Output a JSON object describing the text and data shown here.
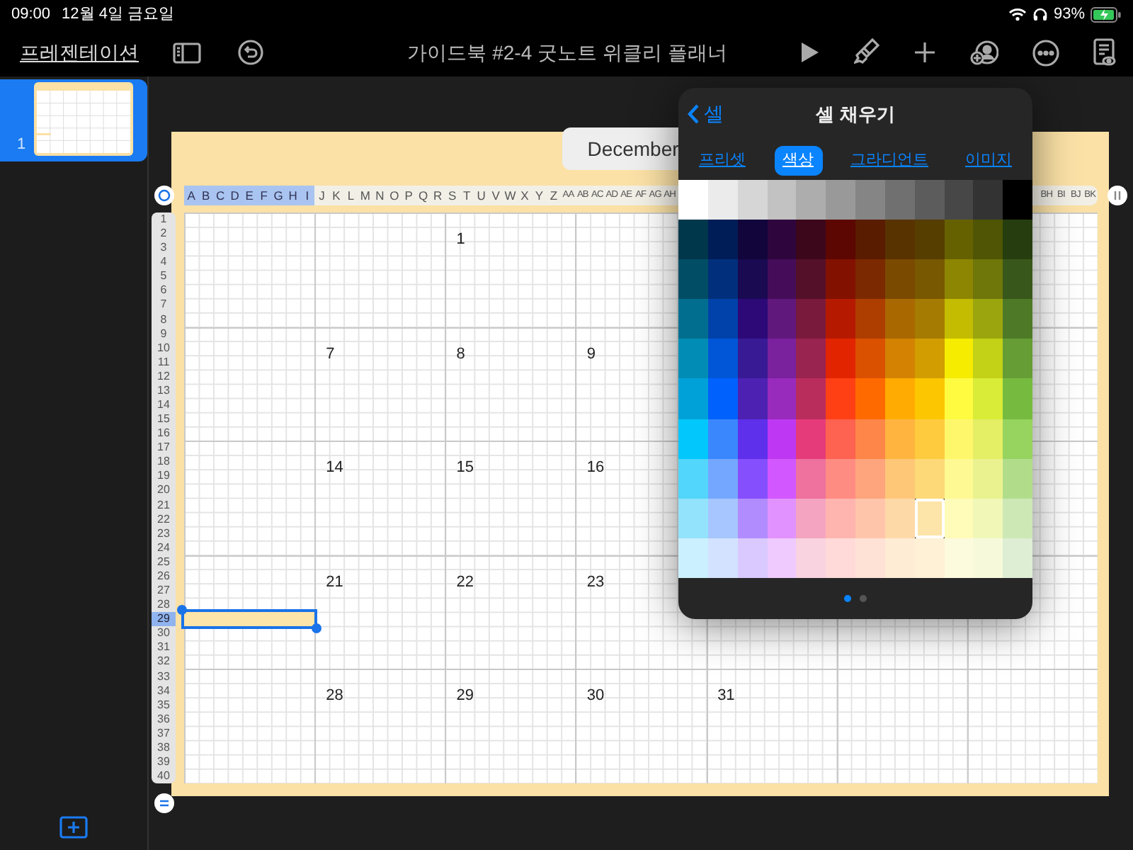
{
  "status_bar": {
    "time": "09:00",
    "date": "12월 4일 금요일",
    "battery": "93%"
  },
  "toolbar": {
    "back_link": "프레젠테이션",
    "title": "가이드북 #2-4 굿노트 위클리 플래너"
  },
  "slides": [
    {
      "number": "1",
      "selected": true
    }
  ],
  "slide": {
    "title": "December"
  },
  "table": {
    "column_headers": [
      {
        "label": "A",
        "selected": true
      },
      {
        "label": "B",
        "selected": true
      },
      {
        "label": "C",
        "selected": true
      },
      {
        "label": "D",
        "selected": true
      },
      {
        "label": "E",
        "selected": true
      },
      {
        "label": "F",
        "selected": true
      },
      {
        "label": "G",
        "selected": true
      },
      {
        "label": "H",
        "selected": true
      },
      {
        "label": "I",
        "selected": true
      },
      {
        "label": "J",
        "selected": false
      },
      {
        "label": "K",
        "selected": false
      },
      {
        "label": "L",
        "selected": false
      },
      {
        "label": "M",
        "selected": false
      },
      {
        "label": "N",
        "selected": false
      },
      {
        "label": "O",
        "selected": false
      },
      {
        "label": "P",
        "selected": false
      },
      {
        "label": "Q",
        "selected": false
      },
      {
        "label": "R",
        "selected": false
      },
      {
        "label": "S",
        "selected": false
      },
      {
        "label": "T",
        "selected": false
      },
      {
        "label": "U",
        "selected": false
      },
      {
        "label": "V",
        "selected": false
      },
      {
        "label": "W",
        "selected": false
      },
      {
        "label": "X",
        "selected": false
      },
      {
        "label": "Y",
        "selected": false
      },
      {
        "label": "Z",
        "selected": false
      },
      {
        "label": "AA",
        "selected": false
      },
      {
        "label": "AB",
        "selected": false
      },
      {
        "label": "AC",
        "selected": false
      },
      {
        "label": "AD",
        "selected": false
      },
      {
        "label": "AE",
        "selected": false
      },
      {
        "label": "AF",
        "selected": false
      },
      {
        "label": "AG",
        "selected": false
      },
      {
        "label": "AH",
        "selected": false
      }
    ],
    "column_headers_end": [
      {
        "label": "BH",
        "selected": false
      },
      {
        "label": "BI",
        "selected": false
      },
      {
        "label": "BJ",
        "selected": false
      },
      {
        "label": "BK",
        "selected": false
      }
    ],
    "row_headers": [
      {
        "label": "1",
        "selected": false
      },
      {
        "label": "2",
        "selected": false
      },
      {
        "label": "3",
        "selected": false
      },
      {
        "label": "4",
        "selected": false
      },
      {
        "label": "5",
        "selected": false
      },
      {
        "label": "6",
        "selected": false
      },
      {
        "label": "7",
        "selected": false
      },
      {
        "label": "8",
        "selected": false
      },
      {
        "label": "9",
        "selected": false
      },
      {
        "label": "10",
        "selected": false
      },
      {
        "label": "11",
        "selected": false
      },
      {
        "label": "12",
        "selected": false
      },
      {
        "label": "13",
        "selected": false
      },
      {
        "label": "14",
        "selected": false
      },
      {
        "label": "15",
        "selected": false
      },
      {
        "label": "16",
        "selected": false
      },
      {
        "label": "17",
        "selected": false
      },
      {
        "label": "18",
        "selected": false
      },
      {
        "label": "19",
        "selected": false
      },
      {
        "label": "20",
        "selected": false
      },
      {
        "label": "21",
        "selected": false
      },
      {
        "label": "22",
        "selected": false
      },
      {
        "label": "23",
        "selected": false
      },
      {
        "label": "24",
        "selected": false
      },
      {
        "label": "25",
        "selected": false
      },
      {
        "label": "26",
        "selected": false
      },
      {
        "label": "27",
        "selected": false
      },
      {
        "label": "28",
        "selected": false
      },
      {
        "label": "29",
        "selected": true
      },
      {
        "label": "30",
        "selected": false
      },
      {
        "label": "31",
        "selected": false
      },
      {
        "label": "32",
        "selected": false
      },
      {
        "label": "33",
        "selected": false
      },
      {
        "label": "34",
        "selected": false
      },
      {
        "label": "35",
        "selected": false
      },
      {
        "label": "36",
        "selected": false
      },
      {
        "label": "37",
        "selected": false
      },
      {
        "label": "38",
        "selected": false
      },
      {
        "label": "39",
        "selected": false
      },
      {
        "label": "40",
        "selected": false
      }
    ],
    "weeks": [
      {
        "tue": "1"
      },
      {
        "mon": "7",
        "tue": "8",
        "wed": "9"
      },
      {
        "mon": "14",
        "tue": "15",
        "wed": "16"
      },
      {
        "mon": "21",
        "tue": "22",
        "wed": "23"
      },
      {
        "mon": "28",
        "tue": "29",
        "wed": "30",
        "thu": "31"
      }
    ]
  },
  "popover": {
    "back": "셀",
    "title": "셀 채우기",
    "tabs": [
      {
        "label": "프리셋",
        "selected": false
      },
      {
        "label": "색상",
        "selected": true
      },
      {
        "label": "그라디언트",
        "selected": false
      },
      {
        "label": "이미지",
        "selected": false
      }
    ],
    "swatch_rows": [
      [
        {
          "color": "#ffffff",
          "selected": false
        },
        {
          "color": "#ebebeb",
          "selected": false
        },
        {
          "color": "#d6d6d6",
          "selected": false
        },
        {
          "color": "#c2c2c2",
          "selected": false
        },
        {
          "color": "#adadad",
          "selected": false
        },
        {
          "color": "#999999",
          "selected": false
        },
        {
          "color": "#858585",
          "selected": false
        },
        {
          "color": "#707070",
          "selected": false
        },
        {
          "color": "#5c5c5c",
          "selected": false
        },
        {
          "color": "#474747",
          "selected": false
        },
        {
          "color": "#333333",
          "selected": false
        },
        {
          "color": "#000000",
          "selected": false
        }
      ],
      [
        {
          "color": "#00374a",
          "selected": false
        },
        {
          "color": "#011d57",
          "selected": false
        },
        {
          "color": "#11053b",
          "selected": false
        },
        {
          "color": "#2e063d",
          "selected": false
        },
        {
          "color": "#3c071b",
          "selected": false
        },
        {
          "color": "#5c0701",
          "selected": false
        },
        {
          "color": "#5a1c00",
          "selected": false
        },
        {
          "color": "#583300",
          "selected": false
        },
        {
          "color": "#563d00",
          "selected": false
        },
        {
          "color": "#666100",
          "selected": false
        },
        {
          "color": "#4f5504",
          "selected": false
        },
        {
          "color": "#263e0f",
          "selected": false
        }
      ],
      [
        {
          "color": "#004d65",
          "selected": false
        },
        {
          "color": "#012f7b",
          "selected": false
        },
        {
          "color": "#1a0a52",
          "selected": false
        },
        {
          "color": "#450d59",
          "selected": false
        },
        {
          "color": "#551029",
          "selected": false
        },
        {
          "color": "#831100",
          "selected": false
        },
        {
          "color": "#7b2900",
          "selected": false
        },
        {
          "color": "#7a4a00",
          "selected": false
        },
        {
          "color": "#785800",
          "selected": false
        },
        {
          "color": "#8d8602",
          "selected": false
        },
        {
          "color": "#6f760a",
          "selected": false
        },
        {
          "color": "#38571a",
          "selected": false
        }
      ],
      [
        {
          "color": "#016e8f",
          "selected": false
        },
        {
          "color": "#0042a9",
          "selected": false
        },
        {
          "color": "#2c0977",
          "selected": false
        },
        {
          "color": "#61187c",
          "selected": false
        },
        {
          "color": "#791a3d",
          "selected": false
        },
        {
          "color": "#b51a00",
          "selected": false
        },
        {
          "color": "#ad3e00",
          "selected": false
        },
        {
          "color": "#a96800",
          "selected": false
        },
        {
          "color": "#a67b01",
          "selected": false
        },
        {
          "color": "#c4bc00",
          "selected": false
        },
        {
          "color": "#9ba50e",
          "selected": false
        },
        {
          "color": "#4e7a27",
          "selected": false
        }
      ],
      [
        {
          "color": "#008cb4",
          "selected": false
        },
        {
          "color": "#0056d6",
          "selected": false
        },
        {
          "color": "#371a94",
          "selected": false
        },
        {
          "color": "#7a219e",
          "selected": false
        },
        {
          "color": "#99244f",
          "selected": false
        },
        {
          "color": "#e22400",
          "selected": false
        },
        {
          "color": "#da5100",
          "selected": false
        },
        {
          "color": "#d38301",
          "selected": false
        },
        {
          "color": "#d19d01",
          "selected": false
        },
        {
          "color": "#f5ec00",
          "selected": false
        },
        {
          "color": "#c3d117",
          "selected": false
        },
        {
          "color": "#669d34",
          "selected": false
        }
      ],
      [
        {
          "color": "#00a1d8",
          "selected": false
        },
        {
          "color": "#0061fd",
          "selected": false
        },
        {
          "color": "#4d22b2",
          "selected": false
        },
        {
          "color": "#982abc",
          "selected": false
        },
        {
          "color": "#b92d5d",
          "selected": false
        },
        {
          "color": "#ff4015",
          "selected": false
        },
        {
          "color": "#ff6a00",
          "selected": false
        },
        {
          "color": "#ffab01",
          "selected": false
        },
        {
          "color": "#fcc700",
          "selected": false
        },
        {
          "color": "#fefb41",
          "selected": false
        },
        {
          "color": "#d9ec37",
          "selected": false
        },
        {
          "color": "#76bb40",
          "selected": false
        }
      ],
      [
        {
          "color": "#01c7fc",
          "selected": false
        },
        {
          "color": "#3a87fd",
          "selected": false
        },
        {
          "color": "#5e30eb",
          "selected": false
        },
        {
          "color": "#be38f3",
          "selected": false
        },
        {
          "color": "#e63b7a",
          "selected": false
        },
        {
          "color": "#fe6250",
          "selected": false
        },
        {
          "color": "#fe8648",
          "selected": false
        },
        {
          "color": "#feb43f",
          "selected": false
        },
        {
          "color": "#fecb3e",
          "selected": false
        },
        {
          "color": "#fff76b",
          "selected": false
        },
        {
          "color": "#e4ef65",
          "selected": false
        },
        {
          "color": "#96d35f",
          "selected": false
        }
      ],
      [
        {
          "color": "#52d6fc",
          "selected": false
        },
        {
          "color": "#74a7ff",
          "selected": false
        },
        {
          "color": "#864ffd",
          "selected": false
        },
        {
          "color": "#d357fe",
          "selected": false
        },
        {
          "color": "#ee719e",
          "selected": false
        },
        {
          "color": "#ff8c82",
          "selected": false
        },
        {
          "color": "#fea57d",
          "selected": false
        },
        {
          "color": "#fec777",
          "selected": false
        },
        {
          "color": "#fed977",
          "selected": false
        },
        {
          "color": "#fff994",
          "selected": false
        },
        {
          "color": "#eaf28f",
          "selected": false
        },
        {
          "color": "#b1dd8b",
          "selected": false
        }
      ],
      [
        {
          "color": "#93e3fc",
          "selected": false
        },
        {
          "color": "#a7c6ff",
          "selected": false
        },
        {
          "color": "#b18cfe",
          "selected": false
        },
        {
          "color": "#e292fe",
          "selected": false
        },
        {
          "color": "#f4a4c0",
          "selected": false
        },
        {
          "color": "#ffb5af",
          "selected": false
        },
        {
          "color": "#ffc5ab",
          "selected": false
        },
        {
          "color": "#fed9a8",
          "selected": false
        },
        {
          "color": "#fde4a8",
          "selected": true
        },
        {
          "color": "#fffbb9",
          "selected": false
        },
        {
          "color": "#f1f7b7",
          "selected": false
        },
        {
          "color": "#cde8b5",
          "selected": false
        }
      ],
      [
        {
          "color": "#cbf0ff",
          "selected": false
        },
        {
          "color": "#d3e2ff",
          "selected": false
        },
        {
          "color": "#d9c9fe",
          "selected": false
        },
        {
          "color": "#efcaff",
          "selected": false
        },
        {
          "color": "#f9d3e0",
          "selected": false
        },
        {
          "color": "#ffdad8",
          "selected": false
        },
        {
          "color": "#ffe2d6",
          "selected": false
        },
        {
          "color": "#feecd4",
          "selected": false
        },
        {
          "color": "#fef1d5",
          "selected": false
        },
        {
          "color": "#fdfbdd",
          "selected": false
        },
        {
          "color": "#f6fadb",
          "selected": false
        },
        {
          "color": "#deeed4",
          "selected": false
        }
      ]
    ],
    "pages": [
      {
        "selected": true
      },
      {
        "selected": false
      }
    ]
  }
}
